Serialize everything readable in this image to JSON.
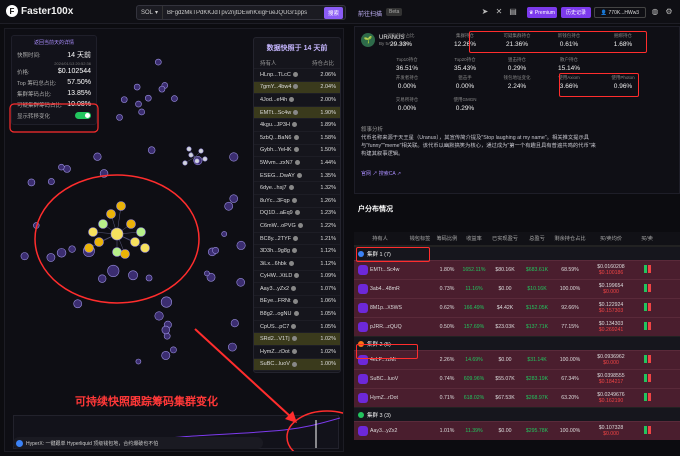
{
  "header": {
    "logo": "Faster100x",
    "chain": "SOL",
    "address": "BFgdzMkTPdKKJdTpv2njtDEwhKxigFueJQUGr1pps",
    "search_button": "搜索",
    "scan_label": "前往扫描",
    "beta": "Beta",
    "premium_label": "Premium",
    "history_label": "历史记录",
    "wallet": "770K...HWw3"
  },
  "stats": {
    "back_label": "返回当前天的详情",
    "rows": [
      {
        "label": "快照时间:",
        "value": "14 天前",
        "sub": "2024/01/13 20:52:36"
      },
      {
        "label": "价格:",
        "value": "$0.102544"
      },
      {
        "label": "Top 筹码总占比:",
        "value": "57.50%"
      },
      {
        "label": "集群筹码占比:",
        "value": "13.85%"
      },
      {
        "label": "可疑集群筹码占比:",
        "value": "10.08%"
      },
      {
        "label": "显示转移变化",
        "toggle": true
      }
    ]
  },
  "snapshot_table": {
    "title": "数据快照于 14 天前",
    "col_holder": "持有人",
    "col_pct": "持仓占比",
    "rows": [
      {
        "holder": "HLnp...TLcC",
        "pct": "2.06%",
        "hl": false
      },
      {
        "holder": "7gmY...4bw4",
        "pct": "2.04%",
        "hl": true
      },
      {
        "holder": "4Jod...ef4h",
        "pct": "2.00%",
        "hl": false
      },
      {
        "holder": "EMTt...Sc4w",
        "pct": "1.90%",
        "hl": true
      },
      {
        "holder": "4kgu...JP3H",
        "pct": "1.89%",
        "hl": false
      },
      {
        "holder": "5zbQ...BaN6",
        "pct": "1.58%",
        "hl": false
      },
      {
        "holder": "Gybh...YeHK",
        "pct": "1.50%",
        "hl": false
      },
      {
        "holder": "5Wvm...zxN7",
        "pct": "1.44%",
        "hl": false
      },
      {
        "holder": "ESEG...DwAY",
        "pct": "1.35%",
        "hl": false
      },
      {
        "holder": "6dye...hsj7",
        "pct": "1.32%",
        "hl": false
      },
      {
        "holder": "8uYc...3Fqp",
        "pct": "1.26%",
        "hl": false
      },
      {
        "holder": "DQ1D...aEq9",
        "pct": "1.23%",
        "hl": false
      },
      {
        "holder": "C6mW...oPVG",
        "pct": "1.22%",
        "hl": false
      },
      {
        "holder": "BC8y...2TYF",
        "pct": "1.21%",
        "hl": false
      },
      {
        "holder": "3D3h...9g8g",
        "pct": "1.12%",
        "hl": false
      },
      {
        "holder": "3iLx...6hbk",
        "pct": "1.12%",
        "hl": false
      },
      {
        "holder": "CyHW...XtLD",
        "pct": "1.09%",
        "hl": false
      },
      {
        "holder": "Aay3...yZx2",
        "pct": "1.07%",
        "hl": false
      },
      {
        "holder": "BEye...FRNt",
        "pct": "1.06%",
        "hl": false
      },
      {
        "holder": "B8g2...ogNU",
        "pct": "1.05%",
        "hl": false
      },
      {
        "holder": "CpUS...pC7",
        "pct": "1.05%",
        "hl": false
      },
      {
        "holder": "SRd2...V1Tj",
        "pct": "1.02%",
        "hl": true
      },
      {
        "holder": "HymZ...rDot",
        "pct": "1.02%",
        "hl": false
      },
      {
        "holder": "SuBC...luoV",
        "pct": "1.00%",
        "hl": true
      },
      {
        "holder": "4eLP...rzMt",
        "pct": "0.98%",
        "hl": false
      }
    ]
  },
  "caption": "可持续快照跟踪筹码集群变化",
  "ticker": "HyperX: 一键跟单 Hyperliquid 顶级钱包地，合约爆破也不怕",
  "token": {
    "name": "URANUS",
    "sub": "By 5AJc...2xbK",
    "metrics": [
      {
        "label": "团队持仓占比",
        "value": "29.33%"
      },
      {
        "label": "集群持仓",
        "value": "12.26%"
      },
      {
        "label": "可疑集群持仓",
        "value": "21.36%"
      },
      {
        "label": "新钱包持仓",
        "value": "0.61%"
      },
      {
        "label": "捆绑持仓",
        "value": "1.68%"
      },
      {
        "label": "Top10持仓",
        "value": "36.51%"
      },
      {
        "label": "Top20持仓",
        "value": "35.43%"
      },
      {
        "label": "狙击持仓",
        "value": "0.29%"
      },
      {
        "label": "散户持仓",
        "value": "15.14%"
      },
      {
        "label": "开发者持仓",
        "value": "0.00%"
      },
      {
        "label": "狙击手",
        "value": "0.00%"
      },
      {
        "label": "钱包地址变化",
        "value": "2.24%"
      },
      {
        "label": "使用Axiom",
        "value": "3.66%"
      },
      {
        "label": "使用Photon",
        "value": "0.96%"
      },
      {
        "label": "交易所持仓",
        "value": "0.00%"
      },
      {
        "label": "使用GMGN",
        "value": "0.29%"
      }
    ],
    "desc_label": "叙事分析",
    "desc": "代币名称来源于天王星（Uranus），其宣传简介提及\"Stop laughing at my name\"。相关推文提示具与\"funny\"\"meme\"相关联。该代币以幽默搞笑为核心，通过成为\"第一个有趣且具有普遍共鸣的代币\"来构建其叙事逻辑。",
    "links": "官网 ↗   搜索CA ↗"
  },
  "distribution": {
    "title": "户分布情况",
    "cols": [
      "持有人",
      "钱包标签",
      "筹码比例",
      "收益率",
      "已实现盈亏",
      "总盈亏",
      "剩余持仓占比",
      "买/卖均价",
      "买/卖"
    ],
    "clusters": [
      {
        "name": "集群 1 (7)",
        "color": "#3b82f6",
        "rows": [
          {
            "who": "EMTt...Sc4w",
            "pct": "1.80%",
            "ret": "1652.11%",
            "real": "$80.16K",
            "total": "$683.61K",
            "left": "68.59%",
            "price": "$0.0160208",
            "price2": "$0.100186"
          },
          {
            "who": "3ab4...48mR",
            "pct": "0.73%",
            "ret": "11.16%",
            "real": "$0.00",
            "total": "$10.16K",
            "left": "100.00%",
            "price": "$0.199654",
            "price2": "$0.000"
          },
          {
            "who": "8M1p...X5WS",
            "pct": "0.62%",
            "ret": "166.49%",
            "real": "$4.42K",
            "total": "$152.05K",
            "left": "92.66%",
            "price": "$0.122924",
            "price2": "$0.157303"
          },
          {
            "who": "pJRR...zQUQ",
            "pct": "0.50%",
            "ret": "157.69%",
            "real": "$23.03K",
            "total": "$137.71K",
            "left": "77.15%",
            "price": "$0.134303",
            "price2": "$0.269241"
          }
        ]
      },
      {
        "name": "集群 2 (5)",
        "color": "#f97316",
        "rows": [
          {
            "who": "4eLP...rzMt",
            "pct": "2.26%",
            "ret": "14.69%",
            "real": "$0.00",
            "total": "$31.14K",
            "left": "100.00%",
            "price": "$0.0936962",
            "price2": "$0.000"
          },
          {
            "who": "SuBC...luoV",
            "pct": "0.74%",
            "ret": "609.96%",
            "real": "$55.07K",
            "total": "$283.19K",
            "left": "67.34%",
            "price": "$0.0398555",
            "price2": "$0.184217"
          },
          {
            "who": "HymZ...rDot",
            "pct": "0.71%",
            "ret": "618.02%",
            "real": "$67.53K",
            "total": "$268.97K",
            "left": "63.20%",
            "price": "$0.0249676",
            "price2": "$0.162190"
          }
        ]
      },
      {
        "name": "集群 3 (3)",
        "color": "#22c55e",
        "rows": [
          {
            "who": "Aay3...yZx2",
            "pct": "1.01%",
            "ret": "11.39%",
            "real": "$0.00",
            "total": "$295.78K",
            "left": "100.00%",
            "price": "$0.107328",
            "price2": "$0.000"
          }
        ]
      }
    ]
  }
}
